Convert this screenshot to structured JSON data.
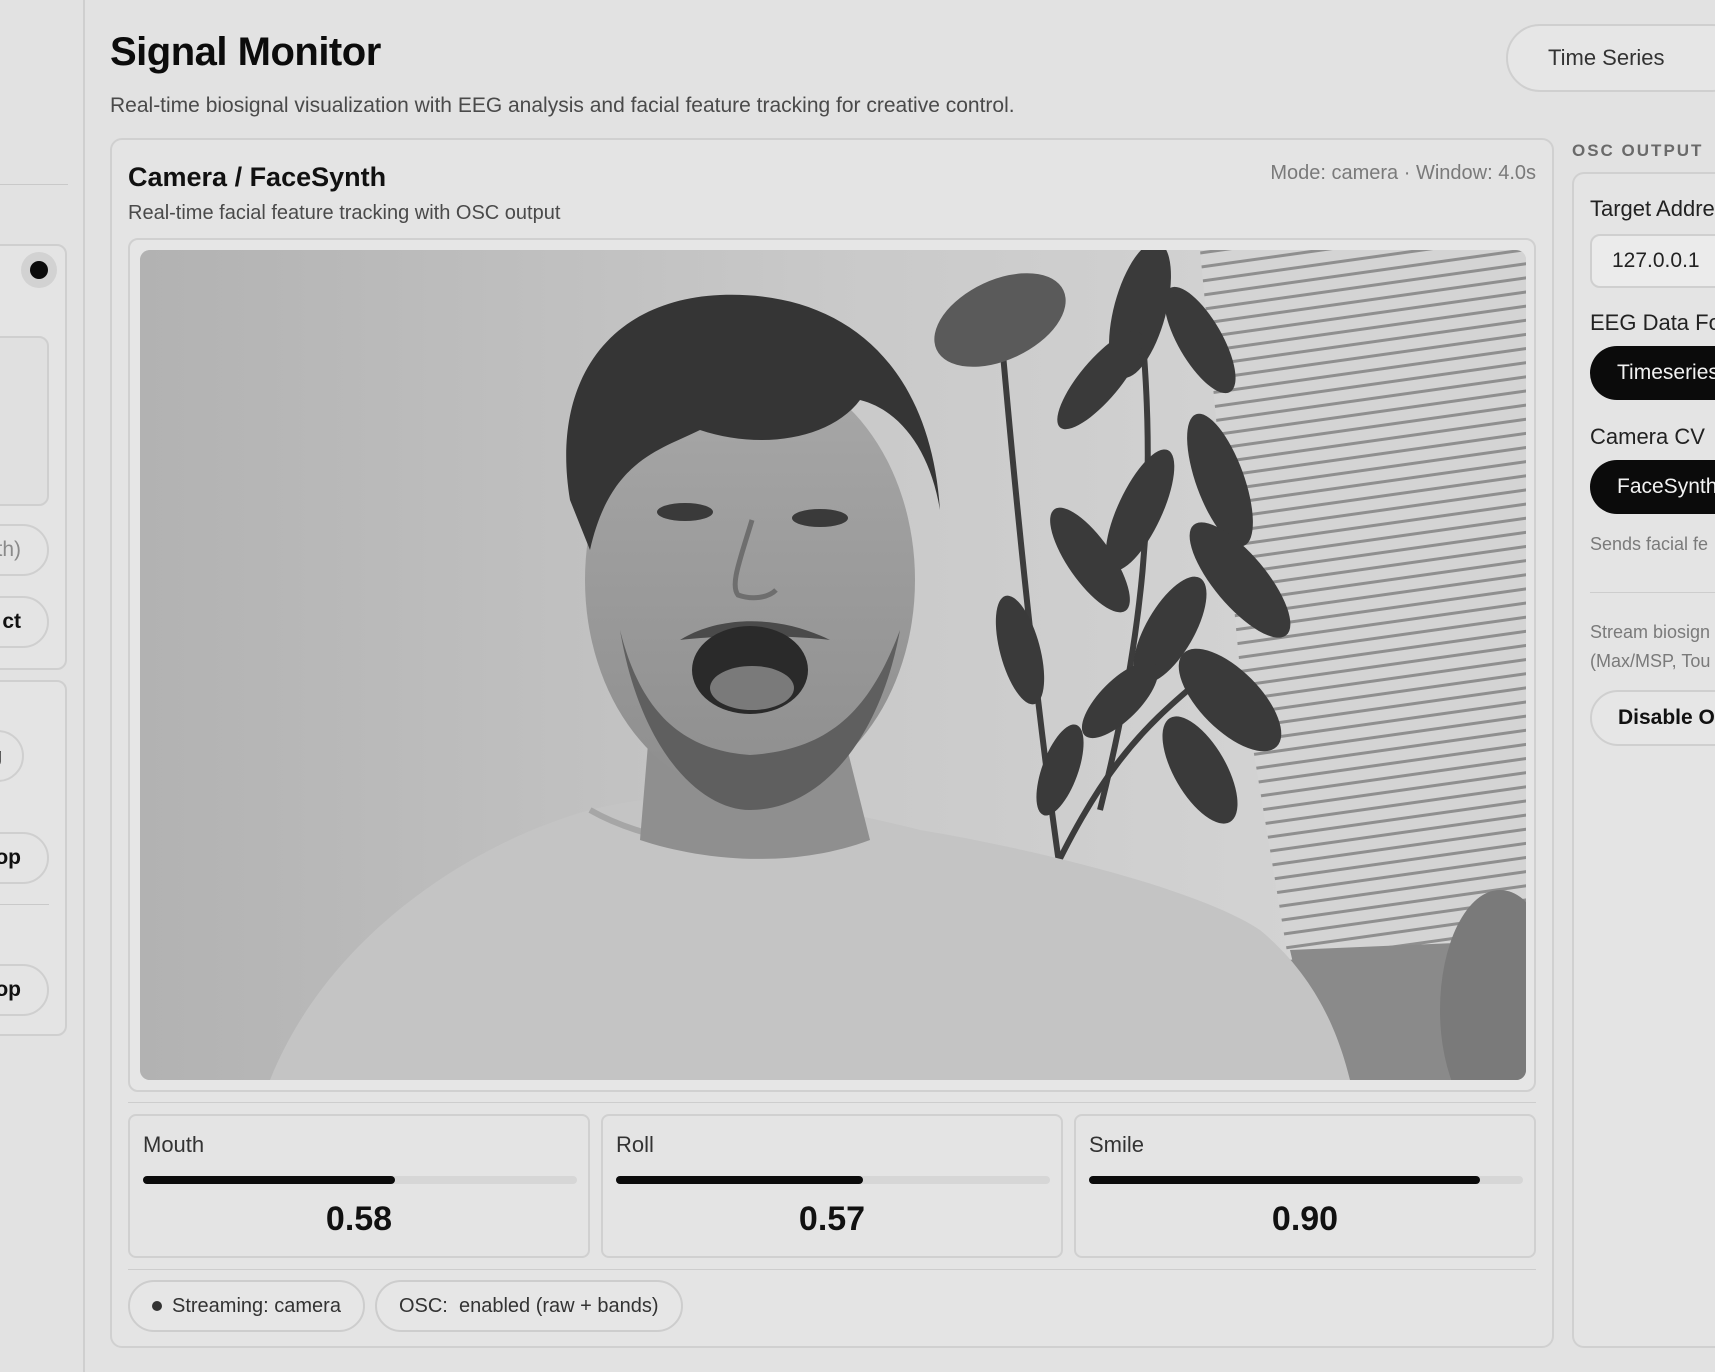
{
  "header": {
    "title": "Signal Monitor",
    "subtitle": "Real-time biosignal visualization with EEG analysis and facial feature tracking for creative control.",
    "view_tab": "Time Series"
  },
  "sidebar": {
    "pill_1": "th)",
    "pill_2": "ct",
    "pill_3": "g",
    "pill_4": "op",
    "pill_5": "op"
  },
  "camera_card": {
    "title": "Camera / FaceSynth",
    "meta": "Mode: camera · Window: 4.0s",
    "subtitle": "Real-time facial feature tracking with OSC output",
    "metrics": [
      {
        "label": "Mouth",
        "value": "0.58",
        "level": 0.58
      },
      {
        "label": "Roll",
        "value": "0.57",
        "level": 0.57
      },
      {
        "label": "Smile",
        "value": "0.90",
        "level": 0.9
      }
    ],
    "status": {
      "streaming": "Streaming: camera",
      "osc": "OSC:  enabled (raw + bands)"
    }
  },
  "osc_panel": {
    "heading": "OSC OUTPUT",
    "target_label": "Target Addre",
    "target_value": "127.0.0.1",
    "eeg_label": "EEG Data Fo",
    "eeg_chip": "Timeseries",
    "camera_label": "Camera CV",
    "camera_chip": "FaceSynth",
    "camera_note": "Sends facial fe",
    "stream_note_1": "Stream biosign",
    "stream_note_2": "(Max/MSP, Tou",
    "disable_button": "Disable O"
  },
  "colors": {
    "background": "#e2e2e2",
    "accent": "#0b0b0b",
    "border": "#cfcfcf"
  }
}
